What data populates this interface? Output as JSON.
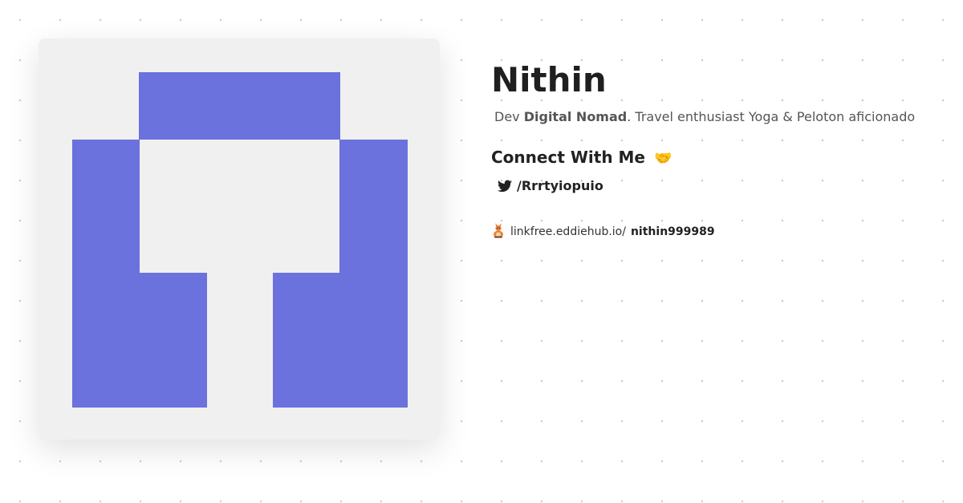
{
  "profile": {
    "name": "Nithin",
    "bio_prefix": "Dev ",
    "bio_highlight": "Digital Nomad",
    "bio_suffix": ". Travel enthusiast Yoga & Peloton aficionado"
  },
  "connect": {
    "heading": "Connect With Me",
    "emoji": "🤝"
  },
  "social": {
    "icon": "twitter-icon",
    "handle": "/Rrrtyiopuio"
  },
  "linkfree": {
    "icon": "linkfree-logo-icon",
    "base": "linkfree.eddiehub.io/",
    "username": "nithin999989"
  },
  "colors": {
    "avatar_fill": "#6b71dd",
    "avatar_background": "#f0f0f0"
  }
}
